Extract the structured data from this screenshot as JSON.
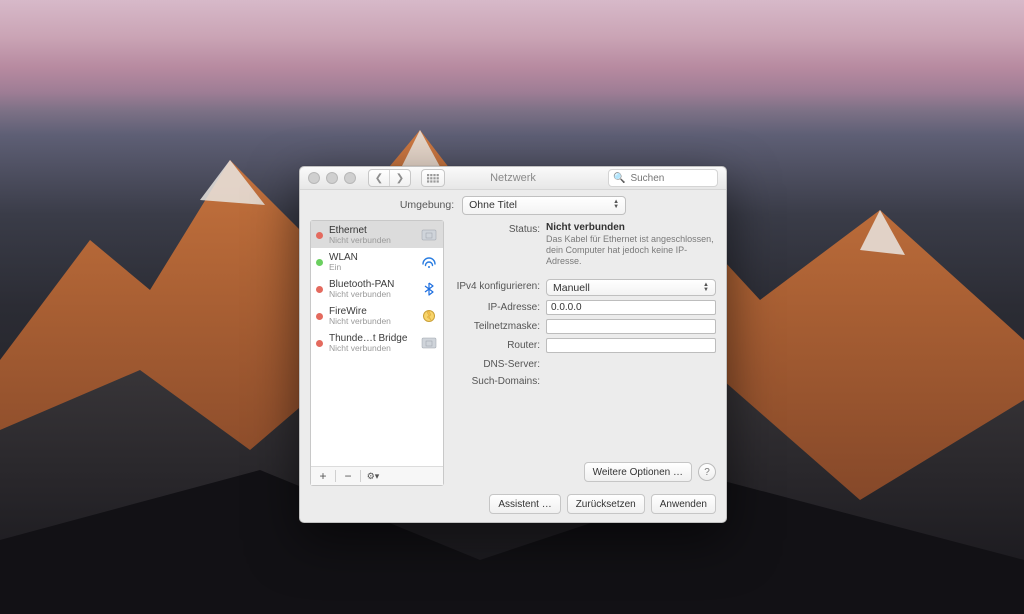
{
  "window": {
    "title": "Netzwerk",
    "search_placeholder": "Suchen"
  },
  "location": {
    "label": "Umgebung:",
    "selected": "Ohne Titel"
  },
  "services": [
    {
      "name": "Ethernet",
      "status_text": "Nicht verbunden",
      "status": "red",
      "icon": "ethernet",
      "selected": true
    },
    {
      "name": "WLAN",
      "status_text": "Ein",
      "status": "green",
      "icon": "wifi",
      "selected": false
    },
    {
      "name": "Bluetooth-PAN",
      "status_text": "Nicht verbunden",
      "status": "red",
      "icon": "bluetooth",
      "selected": false
    },
    {
      "name": "FireWire",
      "status_text": "Nicht verbunden",
      "status": "red",
      "icon": "firewire",
      "selected": false
    },
    {
      "name": "Thunde…t Bridge",
      "status_text": "Nicht verbunden",
      "status": "red",
      "icon": "ethernet",
      "selected": false
    }
  ],
  "detail": {
    "status_label": "Status:",
    "status_value": "Nicht verbunden",
    "status_description": "Das Kabel für Ethernet ist angeschlossen, dein Computer hat jedoch keine IP-Adresse.",
    "ipv4_config_label": "IPv4 konfigurieren:",
    "ipv4_config_value": "Manuell",
    "ip_label": "IP-Adresse:",
    "ip_value": "0.0.0.0",
    "subnet_label": "Teilnetzmaske:",
    "subnet_value": "",
    "router_label": "Router:",
    "router_value": "",
    "dns_label": "DNS-Server:",
    "dns_value": "",
    "searchdomains_label": "Such-Domains:",
    "searchdomains_value": "",
    "advanced_button": "Weitere Optionen …"
  },
  "footer": {
    "assist": "Assistent …",
    "revert": "Zurücksetzen",
    "apply": "Anwenden"
  },
  "sidebar_footer": {
    "add": "+",
    "remove": "−",
    "menu": "⚙︎▾"
  }
}
